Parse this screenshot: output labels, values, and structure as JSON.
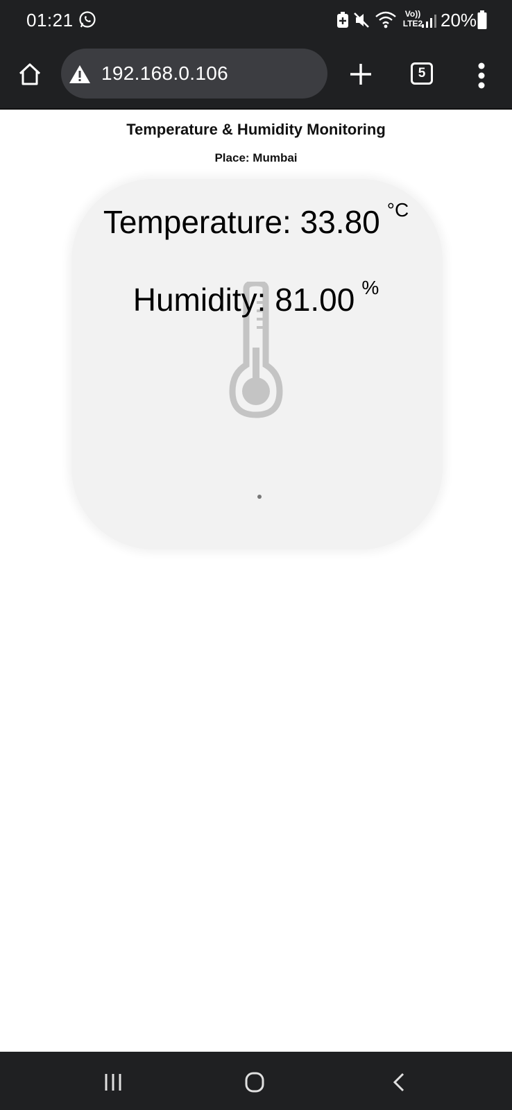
{
  "status_bar": {
    "time": "01:21",
    "battery_percent": "20%",
    "network_label_top": "Vo))",
    "network_label_bottom": "LTE2",
    "icons": [
      "whatsapp-icon",
      "battery-saver-icon",
      "mute-icon",
      "wifi-icon",
      "signal-icon",
      "battery-icon"
    ]
  },
  "browser": {
    "url": "192.168.0.106",
    "tab_count": "5",
    "icons": [
      "home-icon",
      "warning-icon",
      "new-tab-icon",
      "tabs-icon",
      "menu-icon"
    ]
  },
  "page": {
    "title": "Temperature & Humidity Monitoring",
    "place": "Place: Mumbai",
    "temperature_label": "Temperature:",
    "temperature_value": "33.80",
    "temperature_unit": "°C",
    "humidity_label": "Humidity:",
    "humidity_value": "81.00",
    "humidity_unit": "%",
    "card_icon": "thermometer-icon"
  },
  "nav_bar": {
    "icons": [
      "recents-icon",
      "home-nav-icon",
      "back-icon"
    ]
  },
  "colors": {
    "system_bar": "#1f2022",
    "url_pill": "#3c3d41",
    "card_background": "#f2f2f2",
    "thermometer": "#bdbdbd"
  }
}
